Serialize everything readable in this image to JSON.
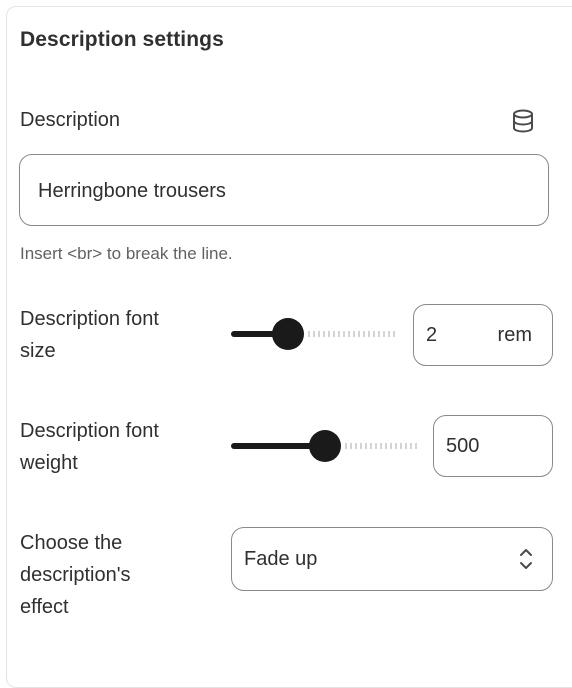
{
  "section": {
    "title": "Description settings"
  },
  "description": {
    "label": "Description",
    "value": "Herringbone trousers",
    "help": "Insert <br> to break the line.",
    "icon": "database-icon"
  },
  "font_size": {
    "label_line1": "Description font",
    "label_line2": "size",
    "value": "2",
    "unit": "rem",
    "slider_fraction": 0.3
  },
  "font_weight": {
    "label_line1": "Description font",
    "label_line2": "weight",
    "value": "500",
    "slider_fraction": 0.5
  },
  "effect": {
    "label_line1": "Choose the",
    "label_line2": "description's",
    "label_line3": "effect",
    "selected": "Fade up",
    "icon": "select-chevron-updown-icon"
  },
  "colors": {
    "text": "#303030",
    "border": "#8a8a8a",
    "slider_fill": "#1a1a1a",
    "help_text": "#616161"
  }
}
